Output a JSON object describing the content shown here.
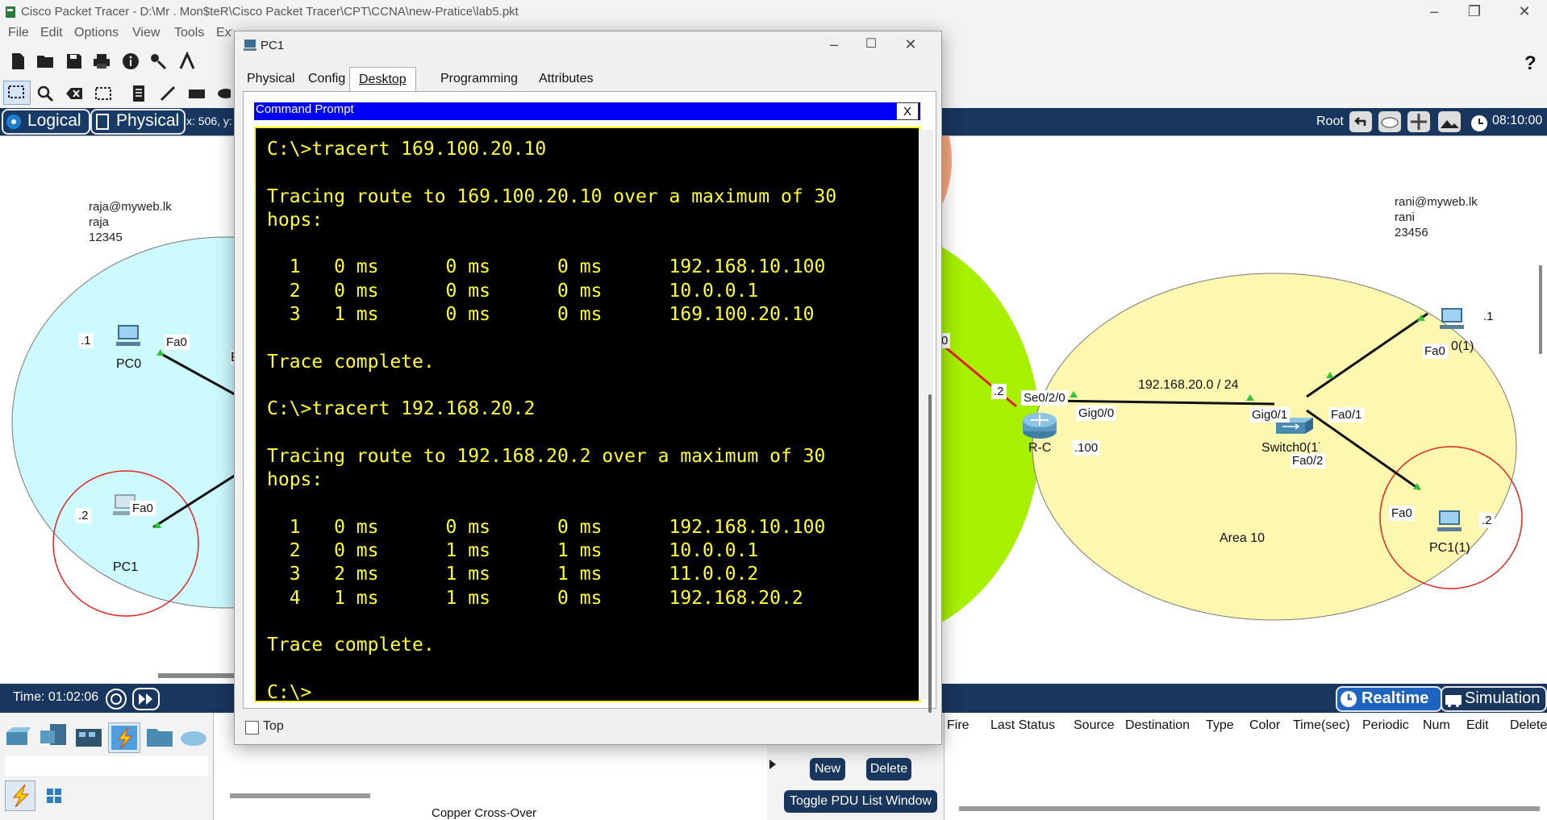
{
  "app": {
    "title": "Cisco Packet Tracer - D:\\Mr . Mon$teR\\Cisco Packet Tracer\\CPT\\CCNA\\new-Pratice\\lab5.pkt",
    "menu": [
      "File",
      "Edit",
      "Options",
      "View",
      "Tools",
      "Extensions"
    ],
    "help_icon": "?"
  },
  "workspace_bar": {
    "logical": "Logical",
    "physical": "Physical",
    "coords": "x: 506, y:",
    "root": "Root",
    "clock": "08:10:00"
  },
  "topology": {
    "left_user": [
      "raja@myweb.lk",
      "raja",
      "12345"
    ],
    "right_user": [
      "rani@myweb.lk",
      "rani",
      "23456"
    ],
    "pc0": "PC0",
    "pc0_port": "Fa0",
    "pc0_ip": ".1",
    "pc1": "PC1",
    "pc1_port": "Fa0",
    "pc1_ip": ".2",
    "router": "R-C",
    "router_serial": "Se0/2/0",
    "router_serial_ip": ".2",
    "router_gig": "Gig0/0",
    "router_gig_ip": ".100",
    "serial_peer_ip": "0",
    "network": "192.168.20.0 / 24",
    "switch": "Switch0(1)",
    "switch_gig": "Gig0/1",
    "switch_fa1": "Fa0/1",
    "switch_fa2": "Fa0/2",
    "pc01": "0(1)",
    "pc01_port": "Fa0",
    "pc01_ip": ".1",
    "pc11": "PC1(1)",
    "pc11_port": "Fa0",
    "pc11_ip": ".2",
    "area": "Area 10",
    "e_label": "E"
  },
  "dialog": {
    "title": "PC1",
    "tabs": [
      "Physical",
      "Config",
      "Desktop",
      "Programming",
      "Attributes"
    ],
    "active_tab": "Desktop",
    "cmd_title": "Command Prompt",
    "cmd_close": "X",
    "terminal": "C:\\>tracert 169.100.20.10\n\nTracing route to 169.100.20.10 over a maximum of 30\nhops:\n\n  1   0 ms      0 ms      0 ms      192.168.10.100\n  2   0 ms      0 ms      0 ms      10.0.0.1\n  3   1 ms      0 ms      0 ms      169.100.20.10\n\nTrace complete.\n\nC:\\>tracert 192.168.20.2\n\nTracing route to 192.168.20.2 over a maximum of 30\nhops:\n\n  1   0 ms      0 ms      0 ms      192.168.10.100\n  2   0 ms      1 ms      1 ms      10.0.0.1\n  3   2 ms      1 ms      1 ms      11.0.0.2\n  4   1 ms      1 ms      0 ms      192.168.20.2\n\nTrace complete.\n\nC:\\>",
    "top_label": "Top"
  },
  "bottom": {
    "time": "Time: 01:02:06",
    "realtime": "Realtime",
    "simulation": "Simulation",
    "cable": "Copper Cross-Over",
    "new": "New",
    "delete": "Delete",
    "toggle": "Toggle PDU List Window",
    "pdu_headers": [
      "Fire",
      "Last Status",
      "Source",
      "Destination",
      "Type",
      "Color",
      "Time(sec)",
      "Periodic",
      "Num",
      "Edit",
      "Delete"
    ]
  },
  "colors": {
    "navy": "#19365e",
    "cyan_area": "#ccfaff",
    "yellow_area": "#fdf7b0",
    "green_area": "#a6f000",
    "orange_area": "#f7a87e",
    "terminal_text": "#ffff33",
    "cmd_title_bg": "#0000f5"
  }
}
